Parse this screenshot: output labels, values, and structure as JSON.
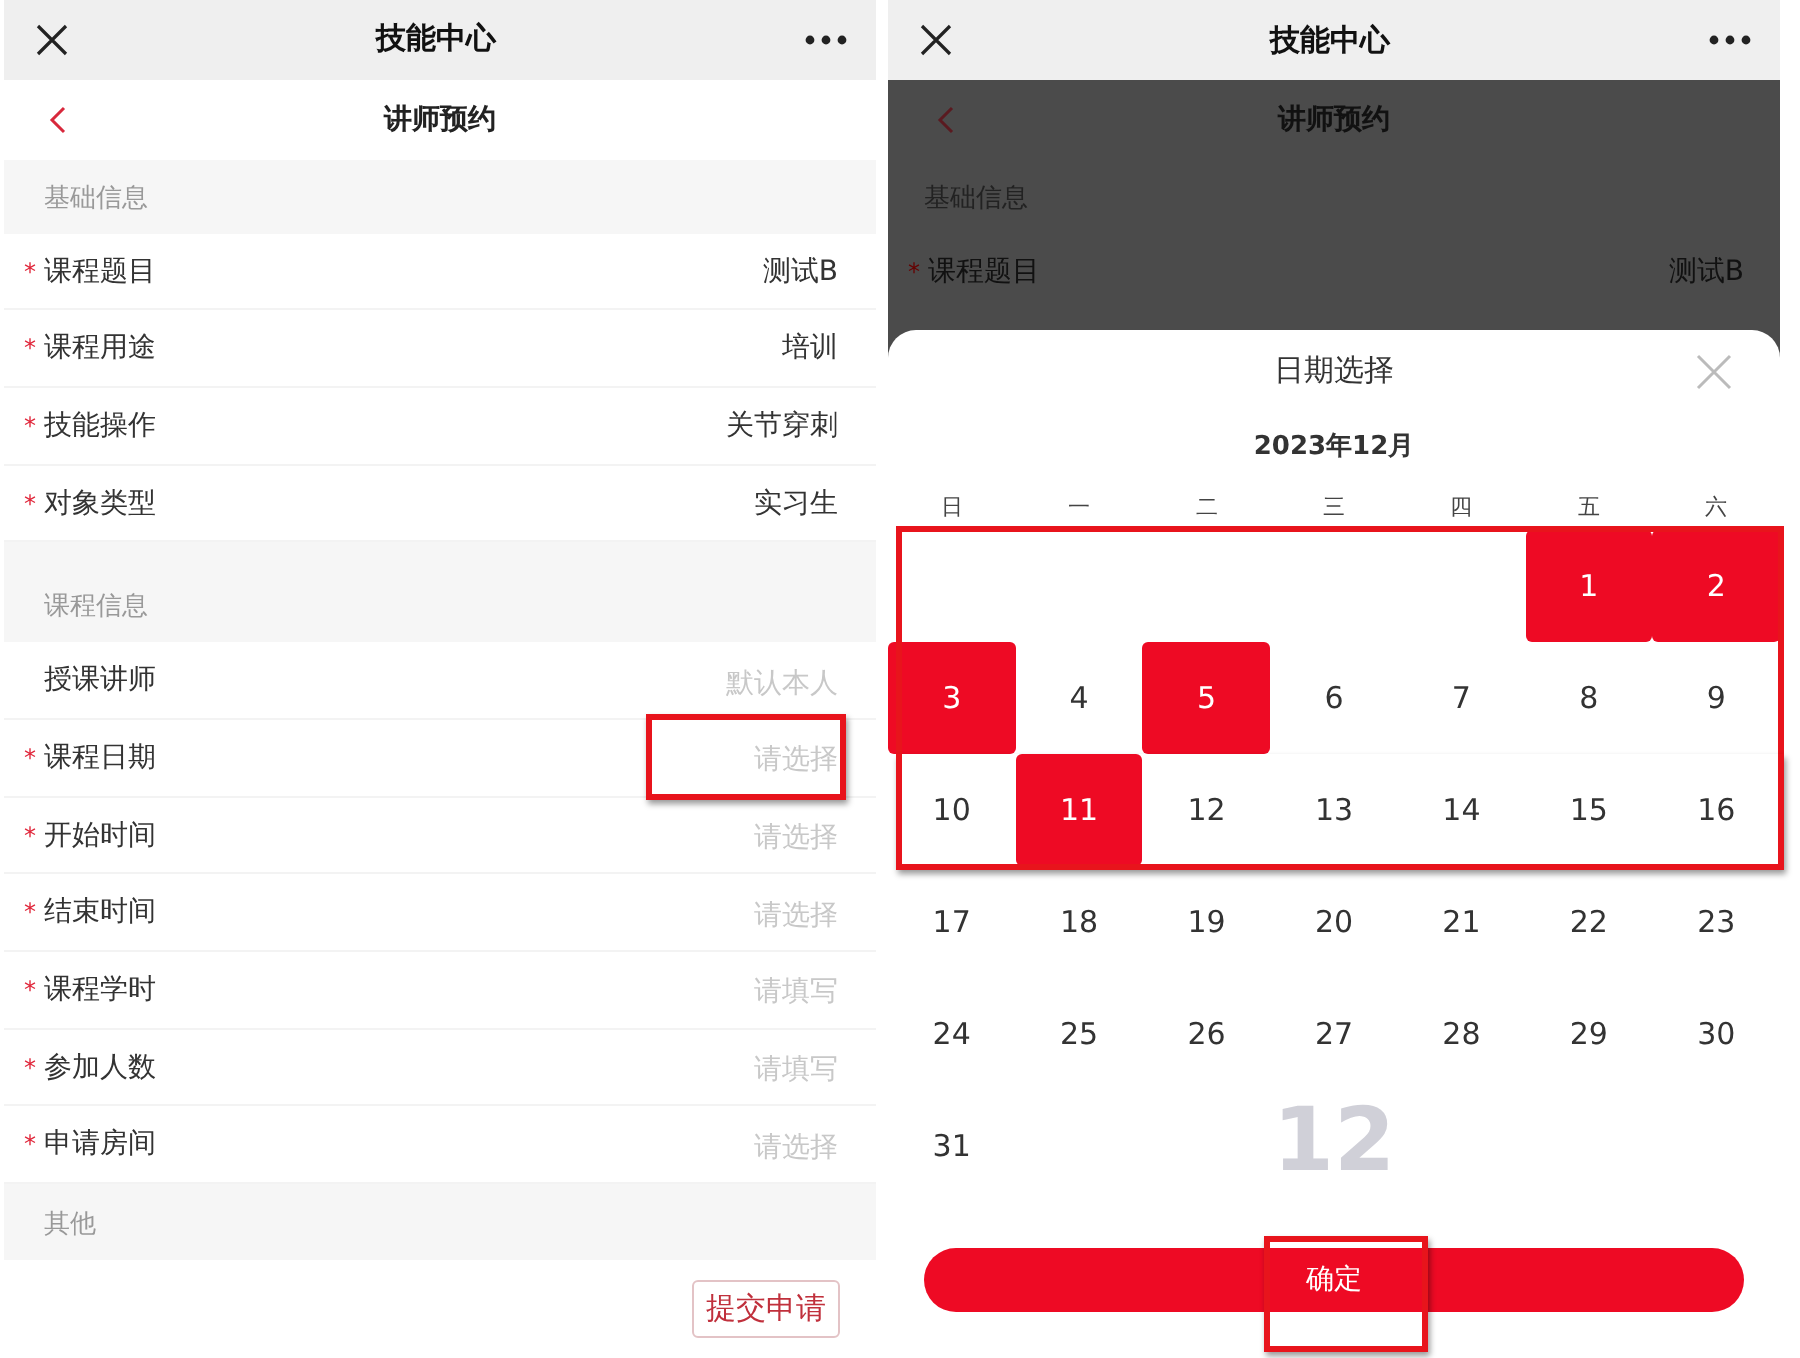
{
  "left": {
    "top_bar": {
      "title": "技能中心"
    },
    "header": {
      "title": "讲师预约"
    },
    "sections": [
      {
        "title": "基础信息",
        "rows": [
          {
            "required_mark": "*",
            "label": "课程题目",
            "value": "测试B"
          },
          {
            "required_mark": "*",
            "label": "课程用途",
            "value": "培训"
          },
          {
            "required_mark": "*",
            "label": "技能操作",
            "value": "关节穿刺"
          },
          {
            "required_mark": "*",
            "label": "对象类型",
            "value": "实习生"
          }
        ]
      },
      {
        "title": "课程信息",
        "rows": [
          {
            "label": "授课讲师",
            "placeholder": "默认本人"
          },
          {
            "required_mark": "*",
            "label": "课程日期",
            "placeholder": "请选择",
            "highlighted": true
          },
          {
            "required_mark": "*",
            "label": "开始时间",
            "placeholder": "请选择"
          },
          {
            "required_mark": "*",
            "label": "结束时间",
            "placeholder": "请选择"
          },
          {
            "required_mark": "*",
            "label": "课程学时",
            "placeholder": "请填写"
          },
          {
            "required_mark": "*",
            "label": "参加人数",
            "placeholder": "请填写"
          },
          {
            "required_mark": "*",
            "label": "申请房间",
            "placeholder": "请选择"
          }
        ]
      },
      {
        "title": "其他"
      }
    ],
    "submit_button": {
      "label": "提交申请"
    }
  },
  "right": {
    "top_bar": {
      "title": "技能中心"
    },
    "background": {
      "header_title": "讲师预约",
      "section_title": "基础信息",
      "row": {
        "required_mark": "*",
        "label": "课程题目",
        "value": "测试B"
      }
    },
    "calendar": {
      "title": "日期选择",
      "month": "2023年12月",
      "month_mark": "12",
      "weekdays": [
        "日",
        "一",
        "二",
        "三",
        "四",
        "五",
        "六"
      ],
      "weeks": [
        {
          "highlighted": true,
          "days": [
            {
              "kind": "blank"
            },
            {
              "kind": "blank"
            },
            {
              "kind": "blank"
            },
            {
              "kind": "blank"
            },
            {
              "kind": "blank"
            },
            {
              "label": "1",
              "selected": true
            },
            {
              "label": "2",
              "selected": true
            }
          ]
        },
        {
          "highlighted": true,
          "days": [
            {
              "label": "3",
              "selected": true
            },
            {
              "label": "4",
              "selected": false
            },
            {
              "label": "5",
              "selected": true
            },
            {
              "label": "6",
              "selected": false
            },
            {
              "label": "7",
              "selected": false
            },
            {
              "label": "8",
              "selected": false
            },
            {
              "label": "9",
              "selected": false
            }
          ]
        },
        {
          "highlighted": true,
          "days": [
            {
              "label": "10",
              "selected": false
            },
            {
              "label": "11",
              "selected": true
            },
            {
              "label": "12",
              "selected": false
            },
            {
              "label": "13",
              "selected": false
            },
            {
              "label": "14",
              "selected": false
            },
            {
              "label": "15",
              "selected": false
            },
            {
              "label": "16",
              "selected": false
            }
          ]
        },
        {
          "days": [
            {
              "label": "17",
              "selected": false
            },
            {
              "label": "18",
              "selected": false
            },
            {
              "label": "19",
              "selected": false
            },
            {
              "label": "20",
              "selected": false
            },
            {
              "label": "21",
              "selected": false
            },
            {
              "label": "22",
              "selected": false
            },
            {
              "label": "23",
              "selected": false
            }
          ]
        },
        {
          "days": [
            {
              "label": "24",
              "selected": false
            },
            {
              "label": "25",
              "selected": false
            },
            {
              "label": "26",
              "selected": false
            },
            {
              "label": "27",
              "selected": false
            },
            {
              "label": "28",
              "selected": false
            },
            {
              "label": "29",
              "selected": false
            },
            {
              "label": "30",
              "selected": false
            }
          ]
        },
        {
          "days": [
            {
              "label": "31",
              "selected": false
            }
          ]
        }
      ],
      "confirm_button": {
        "label": "确定",
        "highlighted": true
      }
    }
  }
}
